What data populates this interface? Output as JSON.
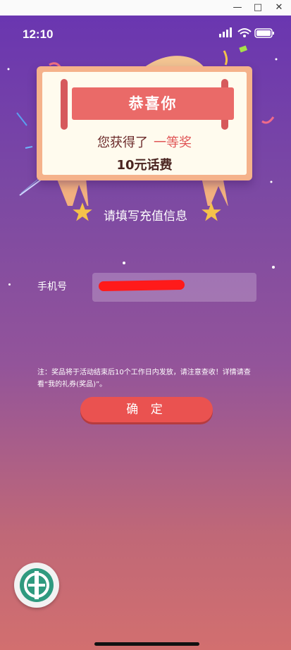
{
  "window": {
    "minimize_glyph": "—",
    "maximize_glyph": "□",
    "close_glyph": "✕"
  },
  "status_bar": {
    "time": "12:10",
    "icons": [
      "signal-icon",
      "wifi-icon",
      "battery-icon"
    ]
  },
  "card": {
    "banner": "恭喜你",
    "won_prefix": "您获得了",
    "prize_level": "一等奖",
    "prize_detail": "10元话费"
  },
  "form": {
    "subtitle": "请填写充值信息",
    "phone_label": "手机号",
    "phone_value": "1",
    "note": "注：奖品将于活动结束后10个工作日内发放，请注意查收！详情请查看“我的礼券(奖品)”。",
    "confirm_label": "确 定"
  },
  "colors": {
    "accent_red": "#ea5250",
    "banner_red": "#ea6a68",
    "card_border": "#f5b28b",
    "prize_text": "#e05556",
    "logo_green": "#2f9a7f"
  },
  "icons": [
    "star-icon",
    "bank-logo-icon"
  ]
}
